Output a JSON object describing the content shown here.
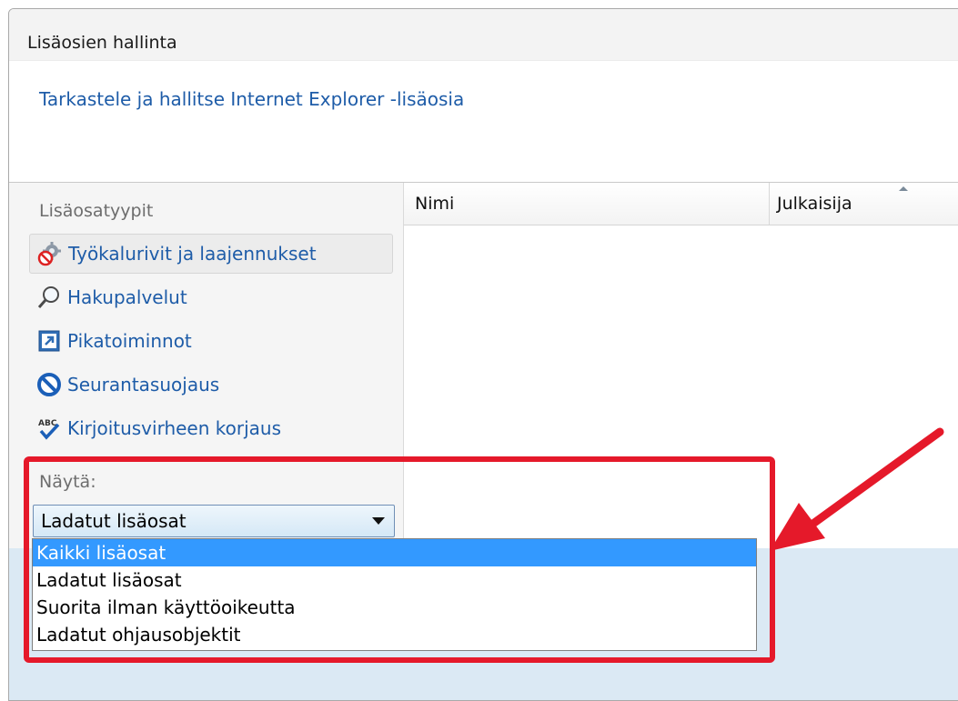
{
  "window": {
    "title": "Lisäosien hallinta",
    "subtitle": "Tarkastele ja hallitse Internet Explorer -lisäosia"
  },
  "left_pane": {
    "types_label": "Lisäosatyypit",
    "items": [
      {
        "label": "Työkalurivit ja laajennukset",
        "icon": "gear-blocked-icon",
        "selected": true
      },
      {
        "label": "Hakupalvelut",
        "icon": "magnifier-icon",
        "selected": false
      },
      {
        "label": "Pikatoiminnot",
        "icon": "accelerator-icon",
        "selected": false
      },
      {
        "label": "Seurantasuojaus",
        "icon": "tracking-protection-icon",
        "selected": false
      },
      {
        "label": "Kirjoitusvirheen korjaus",
        "icon": "spelling-abc-icon",
        "selected": false
      }
    ],
    "show_label": "Näytä:",
    "show_value": "Ladatut lisäosat"
  },
  "columns": {
    "name": "Nimi",
    "publisher": "Julkaisija"
  },
  "dropdown": {
    "options": [
      {
        "label": "Kaikki lisäosat",
        "highlighted": true
      },
      {
        "label": "Ladatut lisäosat",
        "highlighted": false
      },
      {
        "label": "Suorita ilman käyttöoikeutta",
        "highlighted": false
      },
      {
        "label": "Ladatut ohjausobjektit",
        "highlighted": false
      }
    ]
  },
  "colors": {
    "link": "#1e5ca8",
    "highlight": "#3399ff",
    "annotation": "#e5192a",
    "bottom_area": "#dbe9f4"
  }
}
